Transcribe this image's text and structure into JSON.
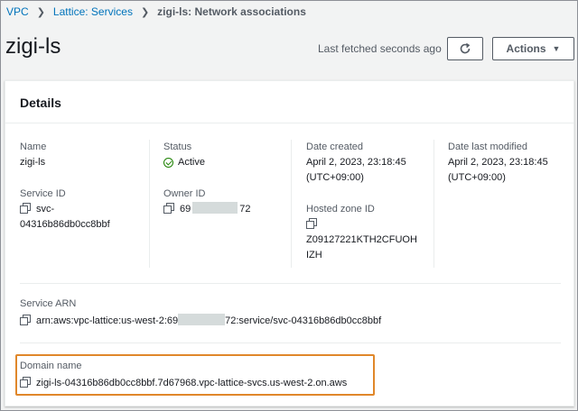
{
  "breadcrumb": {
    "items": [
      "VPC",
      "Lattice: Services"
    ],
    "current": "zigi-ls: Network associations"
  },
  "page": {
    "title": "zigi-ls",
    "fetched": "Last fetched seconds ago",
    "actions_label": "Actions"
  },
  "details": {
    "title": "Details",
    "name": {
      "label": "Name",
      "value": "zigi-ls"
    },
    "service_id": {
      "label": "Service ID",
      "value_line1": "svc-",
      "value_line2": "04316b86db0cc8bbf"
    },
    "status": {
      "label": "Status",
      "value": "Active"
    },
    "owner_id": {
      "label": "Owner ID",
      "prefix": "69",
      "suffix": "72"
    },
    "date_created": {
      "label": "Date created",
      "line1": "April 2, 2023, 23:18:45",
      "line2": "(UTC+09:00)"
    },
    "hosted_zone": {
      "label": "Hosted zone ID",
      "line1": "Z09127221KTH2CFUOH",
      "line2": "IZH"
    },
    "date_modified": {
      "label": "Date last modified",
      "line1": "April 2, 2023, 23:18:45",
      "line2": "(UTC+09:00)"
    },
    "service_arn": {
      "label": "Service ARN",
      "prefix": "arn:aws:vpc-lattice:us-west-2:69",
      "suffix": "72:service/svc-04316b86db0cc8bbf"
    },
    "domain_name": {
      "label": "Domain name",
      "value": "zigi-ls-04316b86db0cc8bbf.7d67968.vpc-lattice-svcs.us-west-2.on.aws"
    }
  },
  "colors": {
    "link": "#0073bb",
    "success": "#1d8102",
    "highlight": "#e0872a"
  }
}
